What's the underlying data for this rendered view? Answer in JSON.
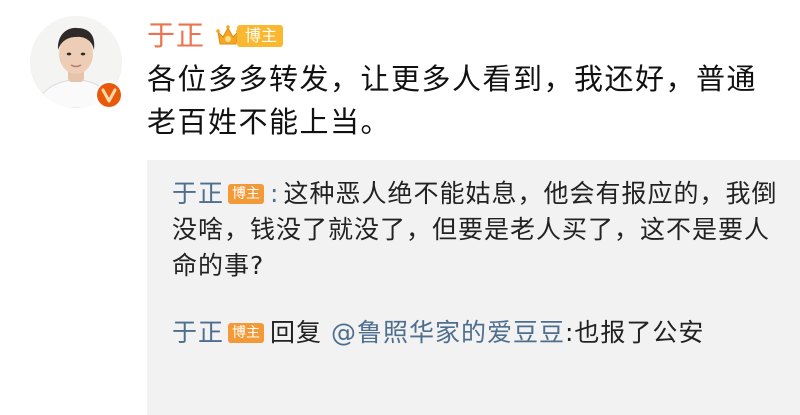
{
  "post": {
    "author": "于正",
    "author_badge": "博主",
    "text": "各位多多转发，让更多人看到，我还好，普通老百姓不能上当。"
  },
  "comments": [
    {
      "author": "于正",
      "badge": "博主",
      "separator": ":",
      "text": "这种恶人绝不能姑息，他会有报应的，我倒没啥，钱没了就没了，但要是老人买了，这不是要人命的事?"
    },
    {
      "author": "于正",
      "badge": "博主",
      "reply_prefix": "回复",
      "mention": "@鲁照华家的爱豆豆",
      "text": ":也报了公安"
    }
  ],
  "icons": {
    "verified": "verified-v-icon",
    "crown": "crown-icon"
  },
  "colors": {
    "author_name": "#eb7350",
    "comment_author": "#4e6e8e",
    "badge_orange": "#f29a38",
    "verified_badge": "#e8590c"
  }
}
